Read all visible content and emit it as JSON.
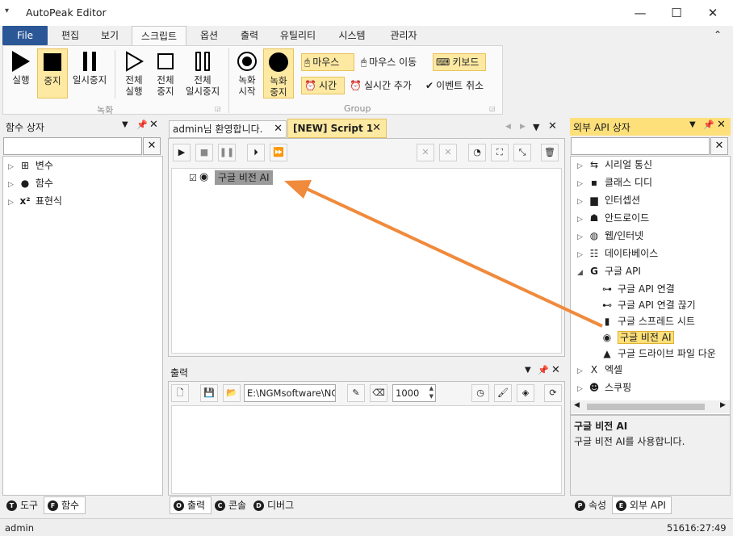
{
  "window": {
    "title": "AutoPeak Editor",
    "minimize": "—",
    "maximize": "☐",
    "close": "✕",
    "qa_icon": "▾"
  },
  "ribbon_tabs": [
    "File",
    "편집",
    "보기",
    "스크립트",
    "옵션",
    "출력",
    "유틸리티",
    "시스템",
    "관리자"
  ],
  "ribbon_collapse": "⌃",
  "ribbon": {
    "run": "실행",
    "stop": "중지",
    "pause": "일시중지",
    "run_all_1": "전체",
    "run_all_2": "실행",
    "stop_all_1": "전체",
    "stop_all_2": "중지",
    "pause_all_1": "전체",
    "pause_all_2": "일시중지",
    "record_start_1": "녹화",
    "record_start_2": "시작",
    "record_stop_1": "녹화",
    "record_stop_2": "중지",
    "mouse": "마우스",
    "mouse_move": "마우스 이동",
    "keyboard": "키보드",
    "time": "시간",
    "realtime_add": "실시간 추가",
    "event_cancel": "이벤트 취소",
    "group_record": "녹화",
    "group_group": "Group"
  },
  "function_box": {
    "title": "함수 상자",
    "items": [
      {
        "icon": "variable-icon",
        "label": "변수"
      },
      {
        "icon": "function-icon",
        "label": "함수"
      },
      {
        "icon": "expression-icon",
        "label": "표현식"
      }
    ],
    "bottom_tabs": [
      {
        "badge": "T",
        "label": "도구"
      },
      {
        "badge": "F",
        "label": "함수"
      }
    ]
  },
  "doc_tabs": {
    "tab1": "admin님 환영합니다.",
    "tab2": "[NEW] Script 1"
  },
  "script": {
    "node_label": "구글 비전 AI"
  },
  "output": {
    "title": "출력",
    "path_value": "E:\\NGMsoftware\\NG",
    "number_value": "1000",
    "bottom_tabs": [
      {
        "badge": "O",
        "label": "출력"
      },
      {
        "badge": "C",
        "label": "콘솔"
      },
      {
        "badge": "D",
        "label": "디버그"
      }
    ]
  },
  "api_box": {
    "title": "외부 API 상자",
    "items": [
      {
        "level": 0,
        "arrow": "▷",
        "icon": "serial-icon",
        "label": "시리얼 통신"
      },
      {
        "level": 0,
        "arrow": "▷",
        "icon": "class-dd-icon",
        "label": "클래스 디디"
      },
      {
        "level": 0,
        "arrow": "▷",
        "icon": "monitor-icon",
        "label": "인터셉션"
      },
      {
        "level": 0,
        "arrow": "▷",
        "icon": "android-icon",
        "label": "안드로이드"
      },
      {
        "level": 0,
        "arrow": "▷",
        "icon": "globe-icon",
        "label": "웹/인터넷"
      },
      {
        "level": 0,
        "arrow": "▷",
        "icon": "database-icon",
        "label": "데이타베이스"
      },
      {
        "level": 0,
        "arrow": "◢",
        "icon": "google-icon",
        "label": "구글 API"
      },
      {
        "level": 1,
        "arrow": "",
        "icon": "link-icon",
        "label": "구글 API 연결"
      },
      {
        "level": 1,
        "arrow": "",
        "icon": "unlink-icon",
        "label": "구글 API 연결 끊기"
      },
      {
        "level": 1,
        "arrow": "",
        "icon": "spreadsheet-icon",
        "label": "구글 스프레드 시트"
      },
      {
        "level": 1,
        "arrow": "",
        "icon": "vision-eye-icon",
        "label": "구글 비전 AI",
        "selected": true
      },
      {
        "level": 1,
        "arrow": "",
        "icon": "drive-icon",
        "label": "구글 드라이브 파일 다운"
      },
      {
        "level": 0,
        "arrow": "▷",
        "icon": "excel-icon",
        "label": "엑셀"
      },
      {
        "level": 0,
        "arrow": "▷",
        "icon": "scraping-icon",
        "label": "스쿠핑"
      }
    ],
    "desc_title": "구글 비전 AI",
    "desc_text": "구글 비전 AI를 사용합니다.",
    "bottom_tabs": [
      {
        "badge": "P",
        "label": "속성"
      },
      {
        "badge": "E",
        "label": "외부 API"
      }
    ]
  },
  "status": {
    "user": "admin",
    "time": "51616:27:49"
  },
  "colors": {
    "file_tab": "#2b5797",
    "highlight": "#fde9a2",
    "arrow": "#f08a3c",
    "selected_panel_header": "#fde07a"
  }
}
